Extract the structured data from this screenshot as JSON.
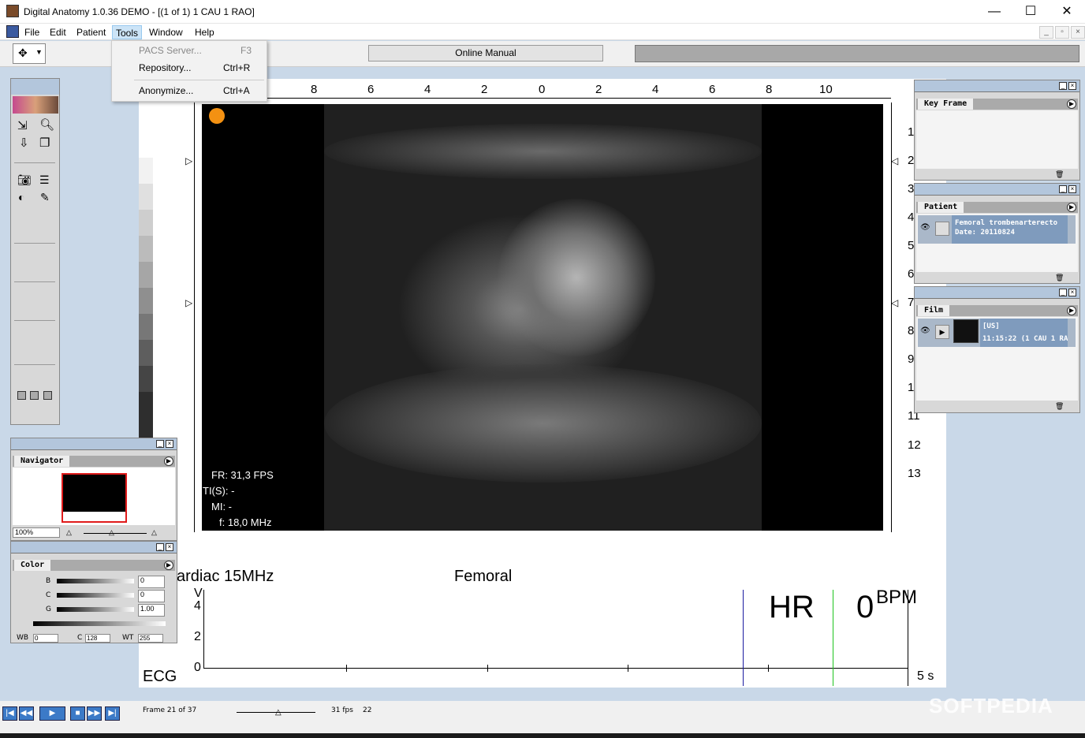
{
  "window": {
    "title": "Digital Anatomy 1.0.36 DEMO - [(1 of 1) 1 CAU 1 RAO]",
    "min": "—",
    "max": "☐",
    "close": "✕"
  },
  "menu": [
    "File",
    "Edit",
    "Patient",
    "Tools",
    "Window",
    "Help"
  ],
  "tools_menu": [
    {
      "label": "PACS Server...",
      "key": "F3",
      "disabled": true
    },
    {
      "label": "Repository...",
      "key": "Ctrl+R",
      "disabled": false
    },
    {
      "label": "Anonymize...",
      "key": "Ctrl+A",
      "disabled": false
    }
  ],
  "toolbar": {
    "online_manual": "Online Manual"
  },
  "ruler_top": [
    "8",
    "6",
    "4",
    "2",
    "0",
    "2",
    "4",
    "6",
    "8",
    "10"
  ],
  "ruler_right": [
    "1",
    "2",
    "3",
    "4",
    "5",
    "6",
    "7",
    "8",
    "9",
    "1",
    "11",
    "12",
    "13"
  ],
  "overlay": {
    "fr": "FR: 31,3 FPS",
    "ti": "TI(S): -",
    "mi": "MI: -",
    "f": "f: 18,0 MHz"
  },
  "labels": {
    "probe": "ardiac 15MHz",
    "region": "Femoral"
  },
  "ecg": {
    "label": "ECG",
    "v": "V",
    "y4": "4",
    "y2": "2",
    "y0": "0",
    "hr": "HR",
    "hr_value": "0",
    "bpm": "BPM",
    "time": "5 s"
  },
  "navigator": {
    "title": "Navigator",
    "zoom": "100%"
  },
  "color": {
    "title": "Color",
    "b_label": "B",
    "b_val": "0",
    "c_label": "C",
    "c_val": "0",
    "g_label": "G",
    "g_val": "1.00",
    "wb": "WB",
    "wb_val": "0",
    "cc": "C",
    "cc_val": "128",
    "wt": "WT",
    "wt_val": "255"
  },
  "key_frame": {
    "title": "Key Frame"
  },
  "patient": {
    "title": "Patient",
    "name": "Femoral trombenarterecto",
    "date": "Date: 20110824"
  },
  "film": {
    "title": "Film",
    "line1": "[US]",
    "line2": "11:15:22 (1 CAU 1 RA"
  },
  "playback": {
    "frame": "Frame 21 of 37",
    "fps": "31 fps",
    "num": "22"
  },
  "watermark": "SOFTPEDIA"
}
